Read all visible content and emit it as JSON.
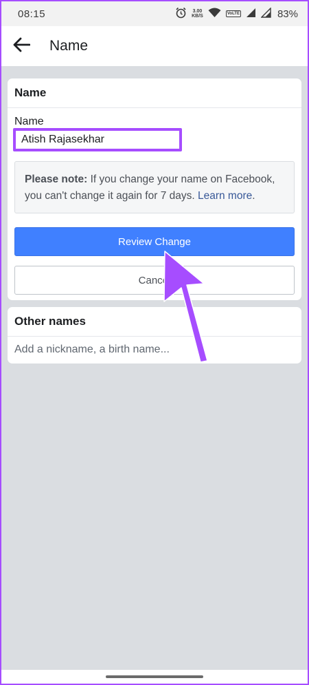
{
  "status_bar": {
    "time": "08:15",
    "speed_value": "3.00",
    "speed_unit": "KB/S",
    "volte_label": "VoLTE",
    "battery": "83%",
    "icons": [
      "alarm-icon",
      "wifi-icon",
      "signal-icon",
      "signal-icon",
      "battery-icon"
    ]
  },
  "header": {
    "back_icon": "arrow-left-icon",
    "title": "Name"
  },
  "name_card": {
    "title": "Name",
    "field_label": "Name",
    "field_value": "Atish Rajasekhar",
    "note_bold": "Please note:",
    "note_text": " If you change your name on Facebook, you can't change it again for 7 days. ",
    "note_link": "Learn more",
    "note_end": ".",
    "review_button": "Review Change",
    "cancel_button": "Cancel"
  },
  "other_names_card": {
    "title": "Other names",
    "add_placeholder": "Add a nickname, a birth name..."
  },
  "colors": {
    "highlight": "#a64dff",
    "primary_button": "#4080ff",
    "link": "#385898",
    "background": "#dadde1"
  }
}
